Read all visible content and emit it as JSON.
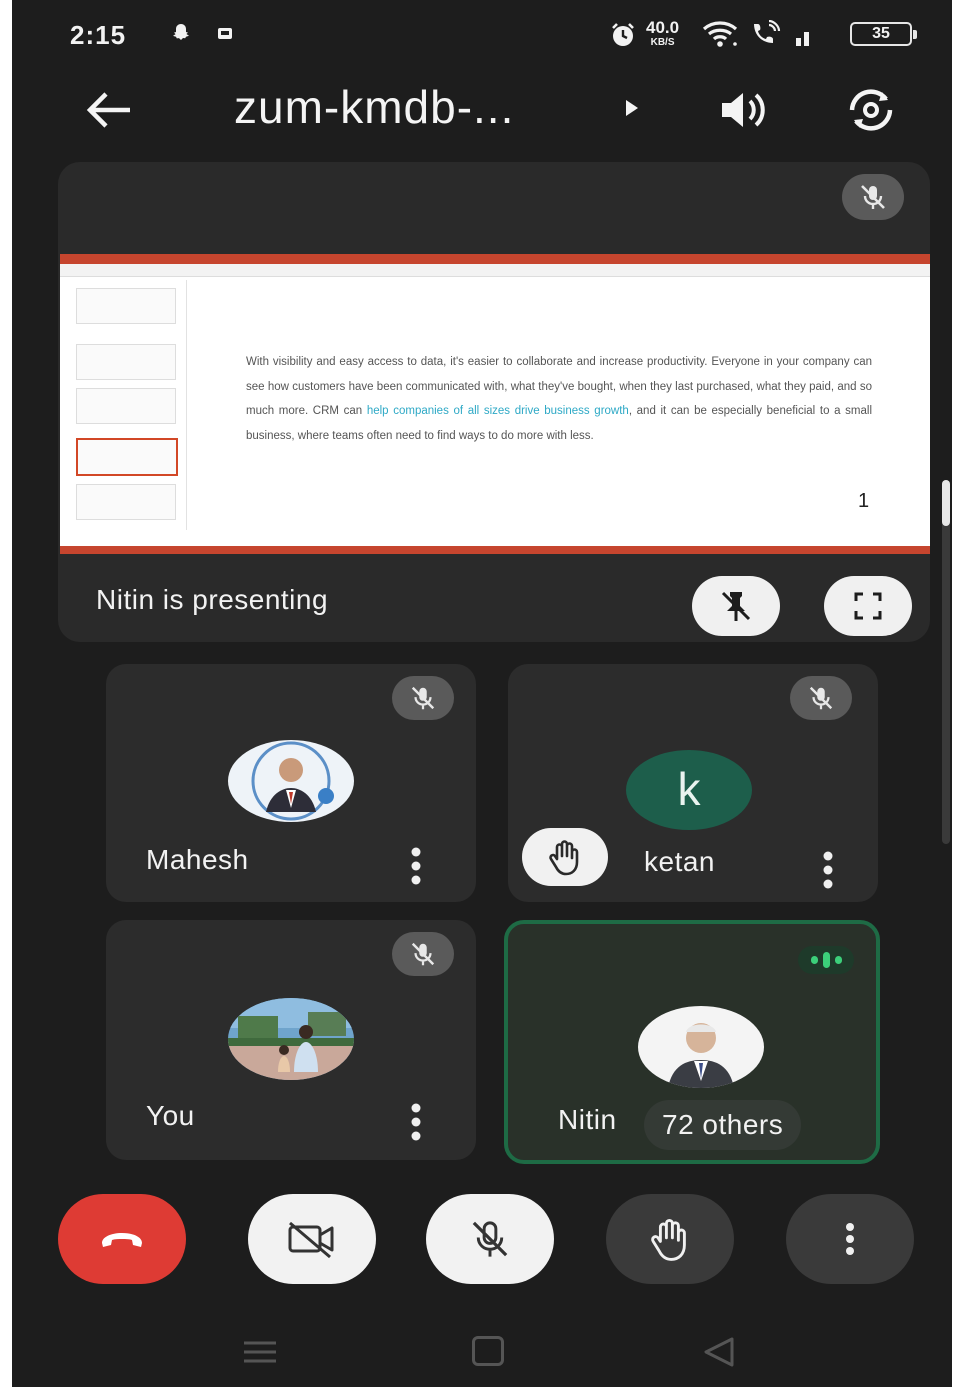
{
  "status_bar": {
    "time": "2:15",
    "net_speed": "40.0",
    "net_unit": "KB/S",
    "battery": "35"
  },
  "app_bar": {
    "meeting_code": "zum-kmdb-..."
  },
  "presentation": {
    "slide_text_before_link": "With visibility and easy access to data, it's easier to collaborate and increase productivity. Everyone in your company can see how customers have been communicated with, what they've bought, when they last purchased, what they paid, and so much more. CRM can ",
    "slide_link": "help companies of all sizes drive business growth",
    "slide_text_after_link": ", and it can be especially beneficial to a small business, where teams often need to find ways to do more with less.",
    "page_number": "1",
    "presenting_label": "Nitin is presenting"
  },
  "participants": {
    "mahesh": {
      "name": "Mahesh",
      "muted": true
    },
    "ketan": {
      "name": "ketan",
      "initial": "k",
      "muted": true,
      "hand_raised": true
    },
    "you": {
      "name": "You",
      "muted": true
    },
    "nitin": {
      "name": "Nitin",
      "others": "72 others",
      "speaking": true
    }
  },
  "controls": {
    "icons": [
      "end-call-icon",
      "camera-off-icon",
      "mic-off-icon",
      "raise-hand-icon",
      "more-options-icon"
    ]
  },
  "colors": {
    "end_call": "#de3b34",
    "speaking_border": "#1e6b45",
    "speaking_indicator": "#3ccf7a",
    "ketan_avatar": "#1d5e4b"
  }
}
